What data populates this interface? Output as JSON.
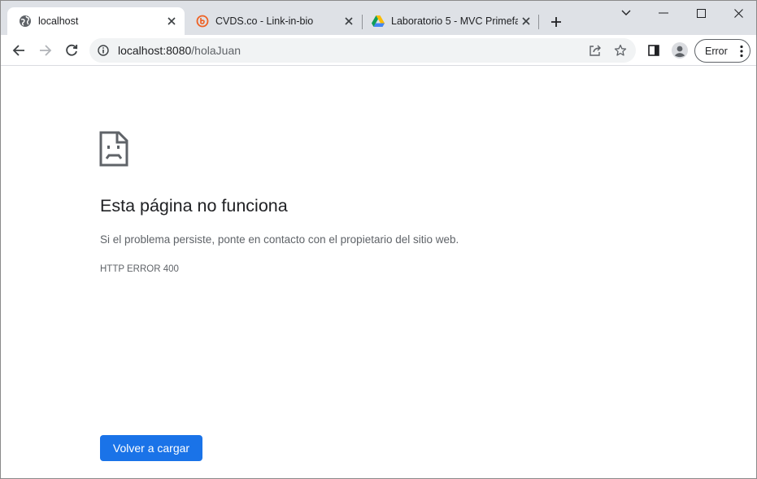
{
  "tabs": [
    {
      "title": "localhost",
      "favicon": "globe-icon",
      "active": true
    },
    {
      "title": "CVDS.co - Link-in-bio",
      "favicon": "bitly-icon",
      "active": false
    },
    {
      "title": "Laboratorio 5 - MVC Primefa",
      "favicon": "google-drive-icon",
      "active": false
    }
  ],
  "toolbar": {
    "url_host": "localhost:8080",
    "url_path": "/holaJuan",
    "error_label": "Error"
  },
  "page": {
    "heading": "Esta página no funciona",
    "description": "Si el problema persiste, ponte en contacto con el propietario del sitio web.",
    "error_code": "HTTP ERROR 400",
    "reload_label": "Volver a cargar"
  },
  "colors": {
    "accent": "#1a73e8",
    "tabstrip": "#dee1e6",
    "bitly_orange": "#ee6123"
  }
}
